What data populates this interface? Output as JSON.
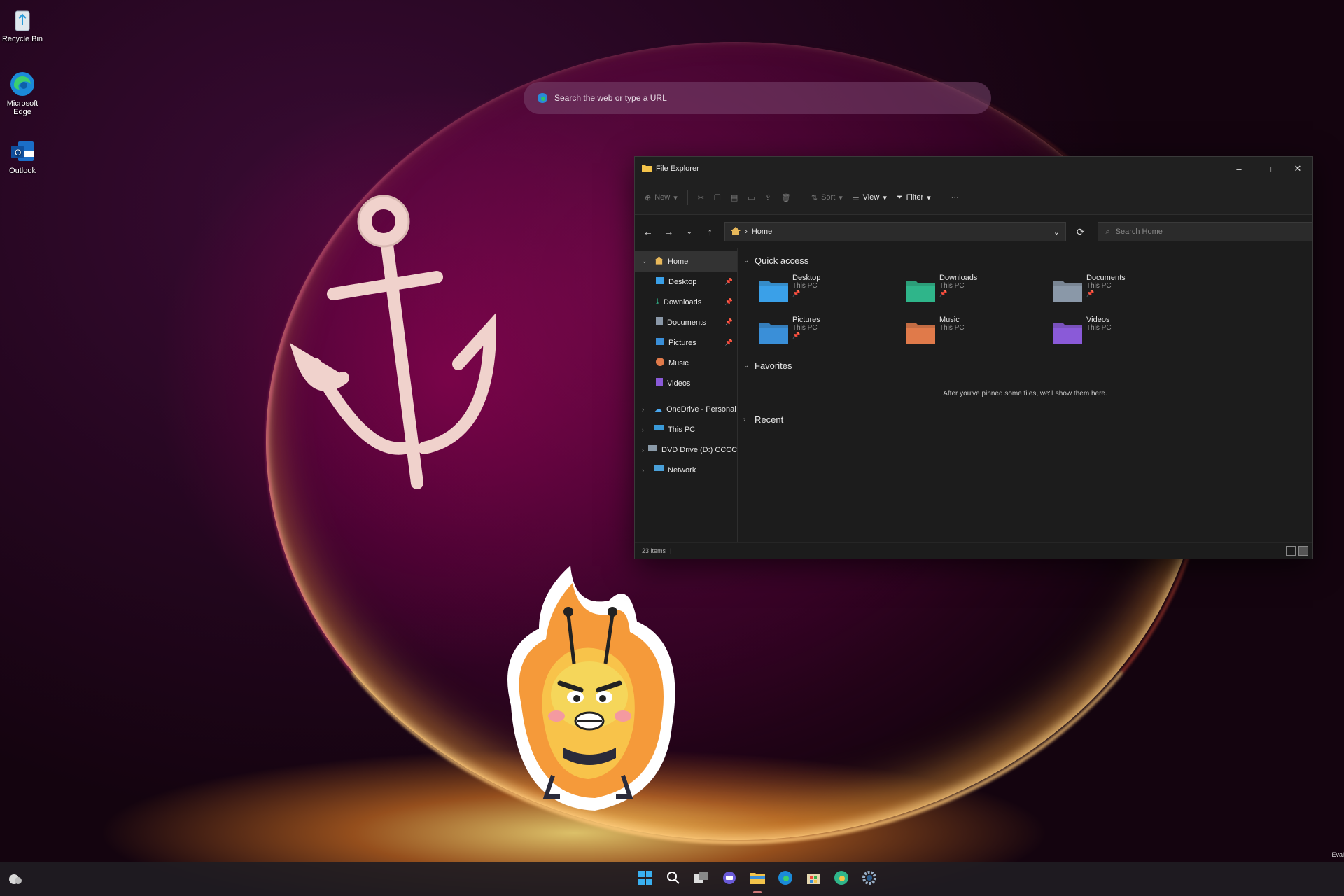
{
  "desktop": {
    "icons": [
      {
        "label": "Recycle Bin",
        "icon": "recycle-bin-icon"
      },
      {
        "label": "Microsoft Edge",
        "icon": "edge-icon"
      },
      {
        "label": "Outlook",
        "icon": "outlook-icon"
      }
    ]
  },
  "search_bar": {
    "placeholder": "Search the web or type a URL"
  },
  "file_explorer": {
    "title": "File Explorer",
    "toolbar": {
      "new": "New",
      "sort": "Sort",
      "view": "View",
      "filter": "Filter",
      "more": "···"
    },
    "address": {
      "path": "Home",
      "search_placeholder": "Search Home"
    },
    "nav": {
      "home": "Home",
      "quick": [
        "Desktop",
        "Downloads",
        "Documents",
        "Pictures",
        "Music",
        "Videos"
      ],
      "drives": [
        "OneDrive - Personal",
        "This PC",
        "DVD Drive (D:) CCCC",
        "Network"
      ]
    },
    "sections": {
      "quick_access": "Quick access",
      "favorites": "Favorites",
      "recent": "Recent",
      "favorites_empty": "After you've pinned some files, we'll show them here."
    },
    "quick_items": [
      {
        "name": "Desktop",
        "location": "This PC",
        "color": "#3aa0e8"
      },
      {
        "name": "Downloads",
        "location": "This PC",
        "color": "#2fb58a"
      },
      {
        "name": "Documents",
        "location": "This PC",
        "color": "#8a98a8"
      },
      {
        "name": "Pictures",
        "location": "This PC",
        "color": "#3a8fd8"
      },
      {
        "name": "Music",
        "location": "This PC",
        "color": "#e07a4a"
      },
      {
        "name": "Videos",
        "location": "This PC",
        "color": "#8a5ad8"
      }
    ],
    "status": "23 items"
  },
  "taskbar": {
    "apps": [
      "start-icon",
      "search-icon",
      "task-view-icon",
      "chat-icon",
      "file-explorer-icon",
      "edge-icon",
      "store-icon",
      "edge-canary-icon",
      "settings-icon"
    ],
    "corner_text": "Eval"
  }
}
